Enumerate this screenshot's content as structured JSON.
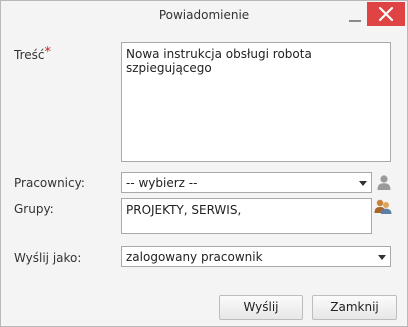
{
  "dialog": {
    "title": "Powiadomienie",
    "minimize_icon": "minimize-icon",
    "close_icon": "close-icon",
    "close_color": "#e04343"
  },
  "form": {
    "content": {
      "label": "Treść",
      "required_mark": "*",
      "value": "Nowa instrukcja obsługi robota szpiegującego"
    },
    "employees": {
      "label": "Pracownicy:",
      "selected": "-- wybierz --",
      "icon": "user-icon"
    },
    "groups": {
      "label": "Grupy:",
      "value": "PROJEKTY,  SERWIS,",
      "icon": "users-group-icon"
    },
    "send_as": {
      "label": "Wyślij jako:",
      "selected": "zalogowany pracownik"
    }
  },
  "buttons": {
    "send": "Wyślij",
    "close": "Zamknij"
  }
}
